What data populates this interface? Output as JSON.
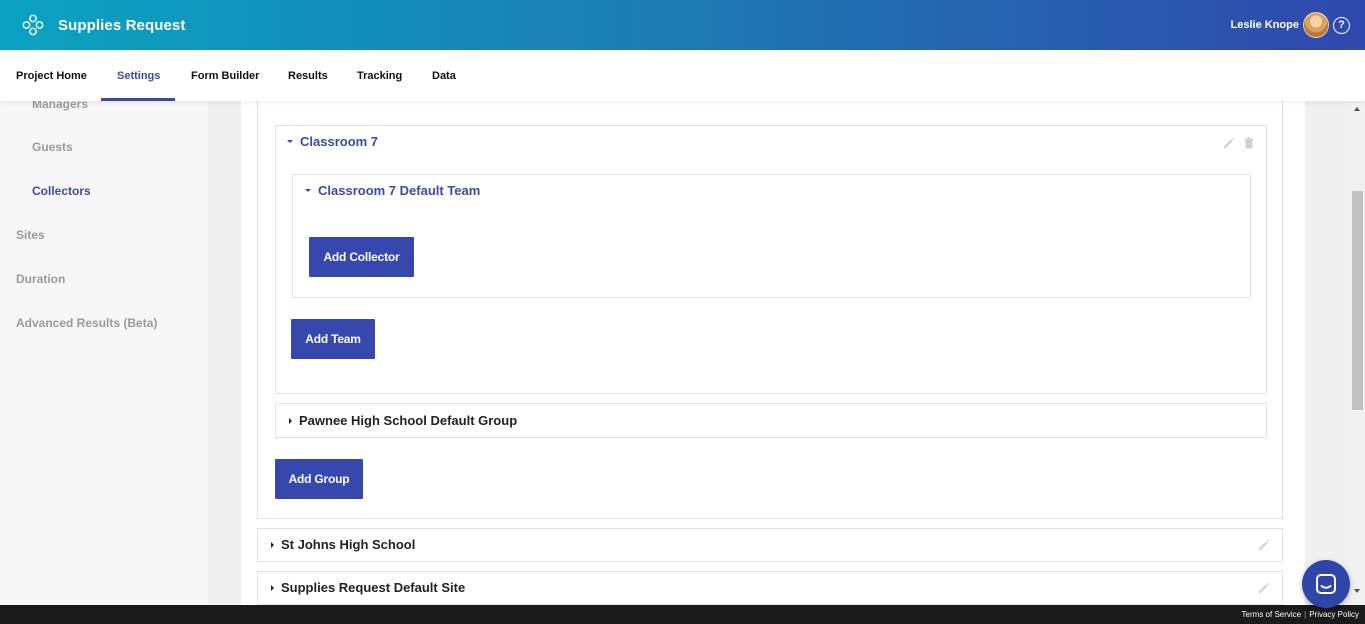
{
  "app": {
    "title": "Supplies Request"
  },
  "user": {
    "name": "Leslie Knope",
    "help": "?"
  },
  "nav": {
    "tabs": [
      {
        "label": "Project Home"
      },
      {
        "label": "Settings"
      },
      {
        "label": "Form Builder"
      },
      {
        "label": "Results"
      },
      {
        "label": "Tracking"
      },
      {
        "label": "Data"
      }
    ],
    "active": "Settings"
  },
  "sidebar": {
    "items": [
      {
        "label": "Managers"
      },
      {
        "label": "Guests"
      },
      {
        "label": "Collectors"
      },
      {
        "label": "Sites"
      },
      {
        "label": "Duration"
      },
      {
        "label": "Advanced Results (Beta)"
      }
    ],
    "active": "Collectors"
  },
  "content": {
    "group": {
      "title": "Classroom 7"
    },
    "team": {
      "title": "Classroom 7 Default Team",
      "add_collector": "Add Collector"
    },
    "add_team": "Add Team",
    "other_group": {
      "title": "Pawnee High School Default Group"
    },
    "add_group": "Add Group",
    "sites": [
      {
        "title": "St Johns High School"
      },
      {
        "title": "Supplies Request Default Site"
      }
    ]
  },
  "footer": {
    "terms": "Terms of Service",
    "separator": "|",
    "privacy": "Privacy Policy"
  },
  "colors": {
    "accent": "#3a4aa6",
    "button": "#3648ad",
    "header_start": "#0aa3c2",
    "header_end": "#3048ad"
  }
}
